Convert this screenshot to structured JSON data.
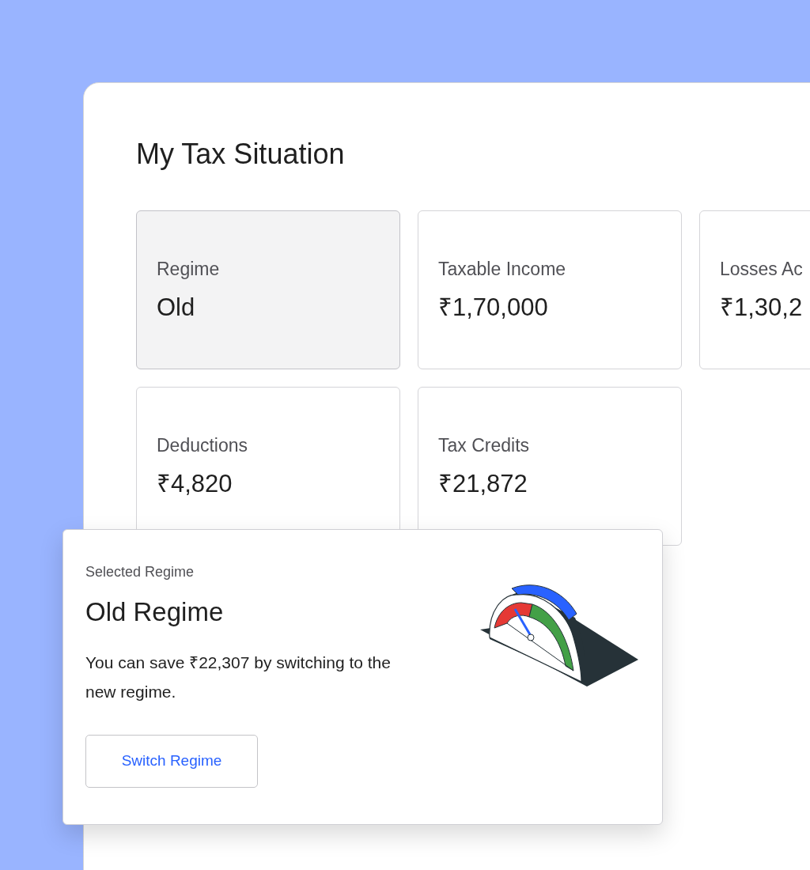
{
  "title": "My Tax Situation",
  "cards": [
    {
      "label": "Regime",
      "value": "Old",
      "selected": true
    },
    {
      "label": "Taxable Income",
      "value": "₹1,70,000",
      "selected": false
    },
    {
      "label": "Losses Ac",
      "value": "₹1,30,2",
      "selected": false
    },
    {
      "label": "Deductions",
      "value": "₹4,820",
      "selected": false
    },
    {
      "label": "Tax Credits",
      "value": "₹21,872",
      "selected": false
    }
  ],
  "regime_card": {
    "caption": "Selected Regime",
    "heading": "Old Regime",
    "message": "You can save ₹22,307 by switching to the new regime.",
    "button": "Switch Regime"
  }
}
